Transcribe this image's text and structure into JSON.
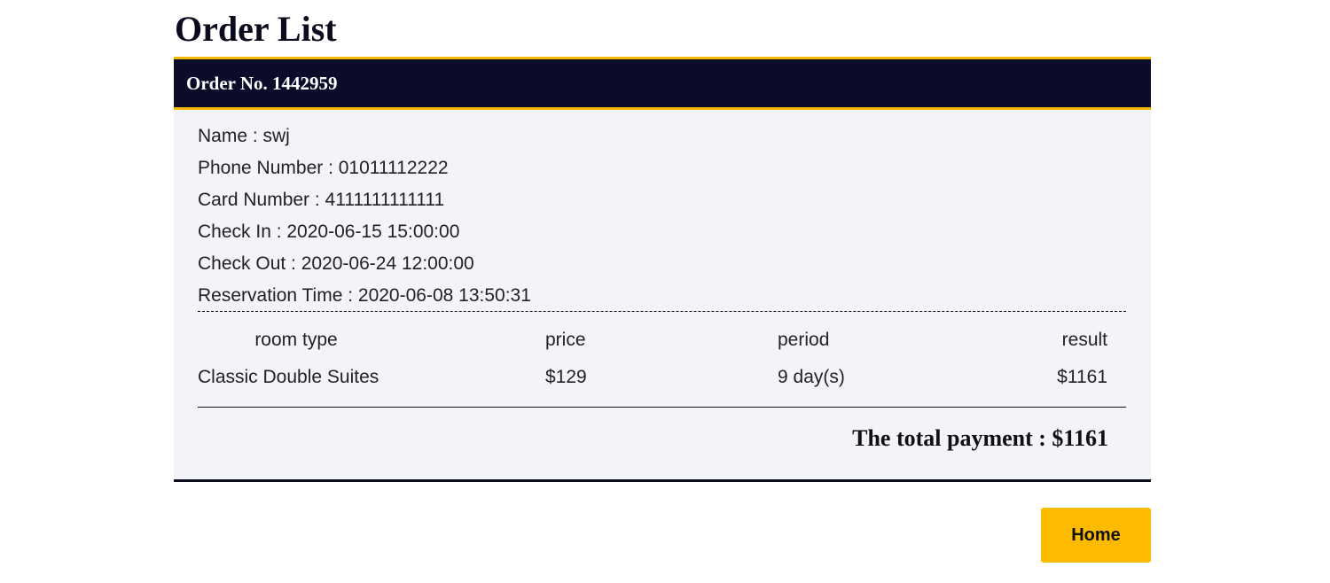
{
  "page": {
    "title": "Order List"
  },
  "order": {
    "header": "Order No. 1442959",
    "info": [
      "Name : swj",
      "Phone Number : 01011112222",
      "Card Number : 4111111111111",
      "Check In : 2020-06-15 15:00:00",
      "Check Out : 2020-06-24 12:00:00",
      "Reservation Time : 2020-06-08 13:50:31"
    ],
    "table": {
      "headers": [
        "room type",
        "price",
        "period",
        "result"
      ],
      "rows": [
        [
          "Classic Double Suites",
          "$129",
          "9 day(s)",
          "$1161"
        ]
      ]
    },
    "total_payment": "The total payment : $1161"
  },
  "actions": {
    "home_label": "Home"
  },
  "colors": {
    "header_bg": "#0b0b2a",
    "accent": "#f5b800",
    "card_bg": "#f3f4f9",
    "home_button": "#fdbb00"
  }
}
